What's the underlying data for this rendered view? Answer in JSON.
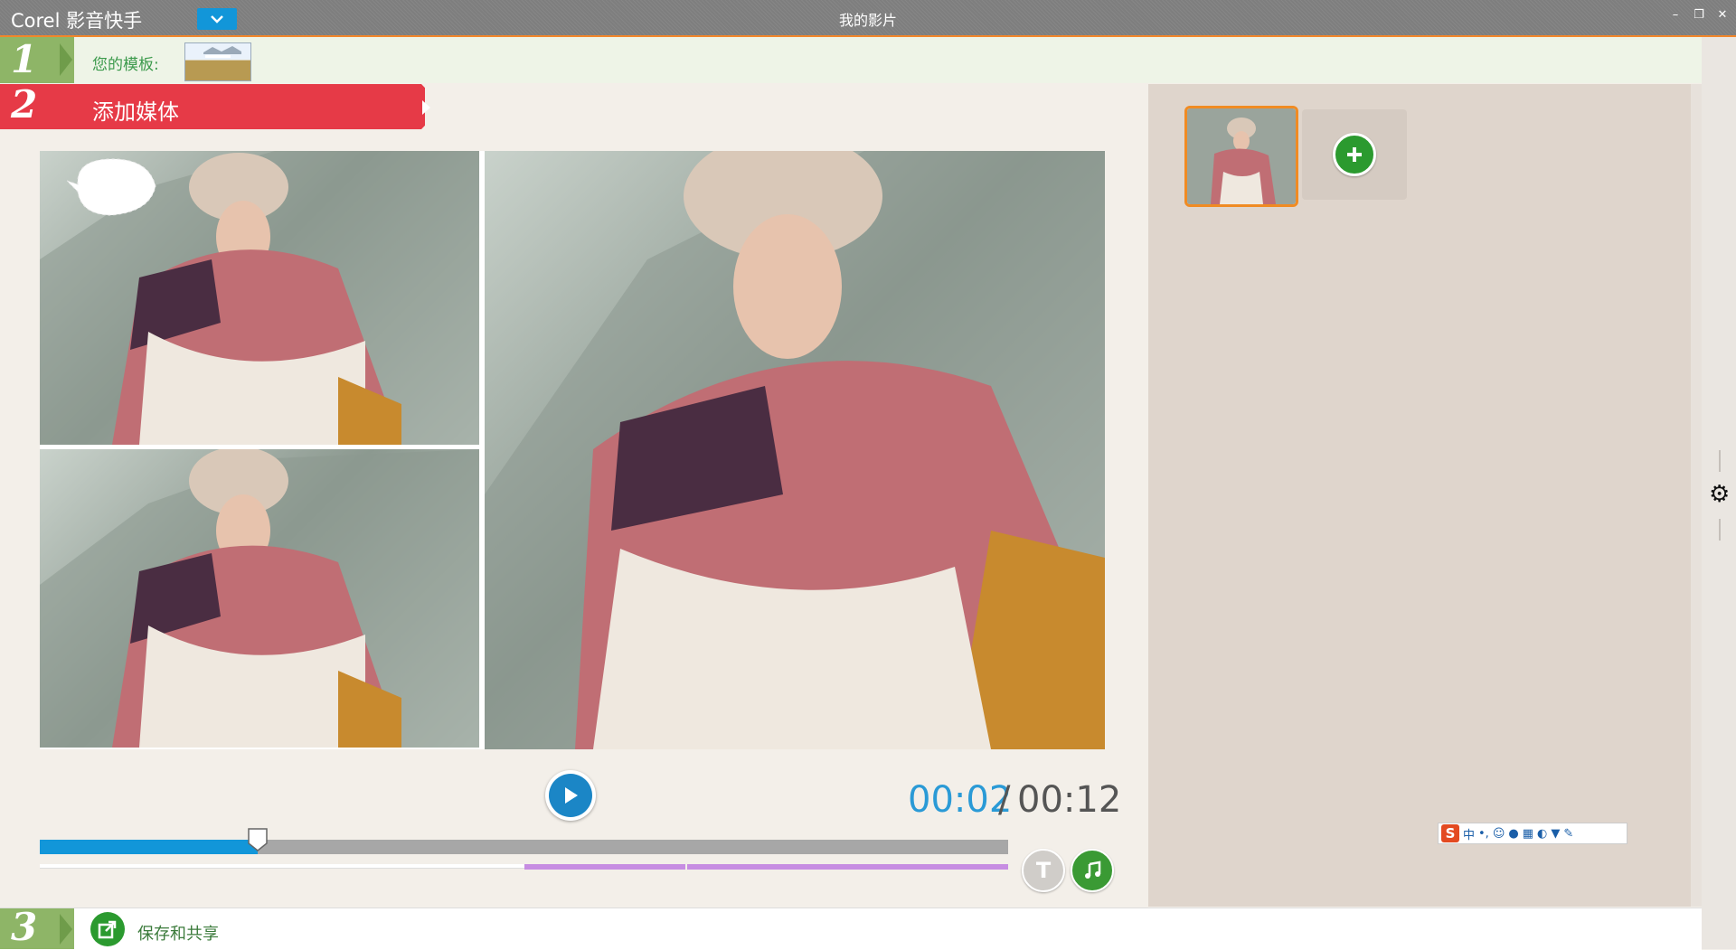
{
  "titlebar": {
    "app_title": "Corel 影音快手",
    "window_title": "我的影片",
    "minimize_glyph": "–",
    "restore_glyph": "❐",
    "close_glyph": "✕"
  },
  "step1": {
    "number": "1",
    "label": "您的模板:"
  },
  "step2": {
    "number": "2",
    "label": "添加媒体"
  },
  "playback": {
    "current_time": "00:02",
    "separator": "/",
    "total_time": "00:12",
    "progress_fraction": 0.225,
    "text_button_glyph": "T"
  },
  "step3": {
    "number": "3",
    "label": "保存和共享"
  },
  "ime_toolbar": {
    "logo": "S",
    "mode": "中",
    "punct": "•,"
  },
  "colors": {
    "accent_blue": "#1296d9",
    "step_green": "#8eb567",
    "step2_red": "#e63a47",
    "selection_orange": "#f08b23",
    "audio_track_purple": "#c78de2"
  },
  "icons": [
    "chevron-down-icon",
    "play-icon",
    "text-icon",
    "music-note-icon",
    "plus-icon",
    "share-icon",
    "gear-icon"
  ]
}
